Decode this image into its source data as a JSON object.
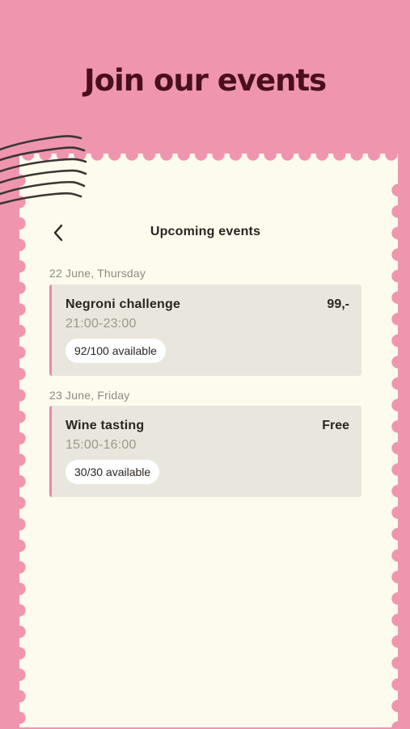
{
  "headline": "Join our events",
  "nav": {
    "title": "Upcoming events",
    "back_icon": "chevron-left-icon"
  },
  "decoration": {
    "postmark_icon": "postmark-wavy-lines-icon",
    "background_color": "#ef96ae",
    "stamp_color": "#fdfaee",
    "accent_color": "#e98aa3"
  },
  "groups": [
    {
      "date": "22 June, Thursday",
      "events": [
        {
          "title": "Negroni challenge",
          "time": "21:00-23:00",
          "price": "99,-",
          "availability": "92/100 available"
        }
      ]
    },
    {
      "date": "23 June, Friday",
      "events": [
        {
          "title": "Wine tasting",
          "time": "15:00-16:00",
          "price": "Free",
          "availability": "30/30 available"
        }
      ]
    }
  ]
}
